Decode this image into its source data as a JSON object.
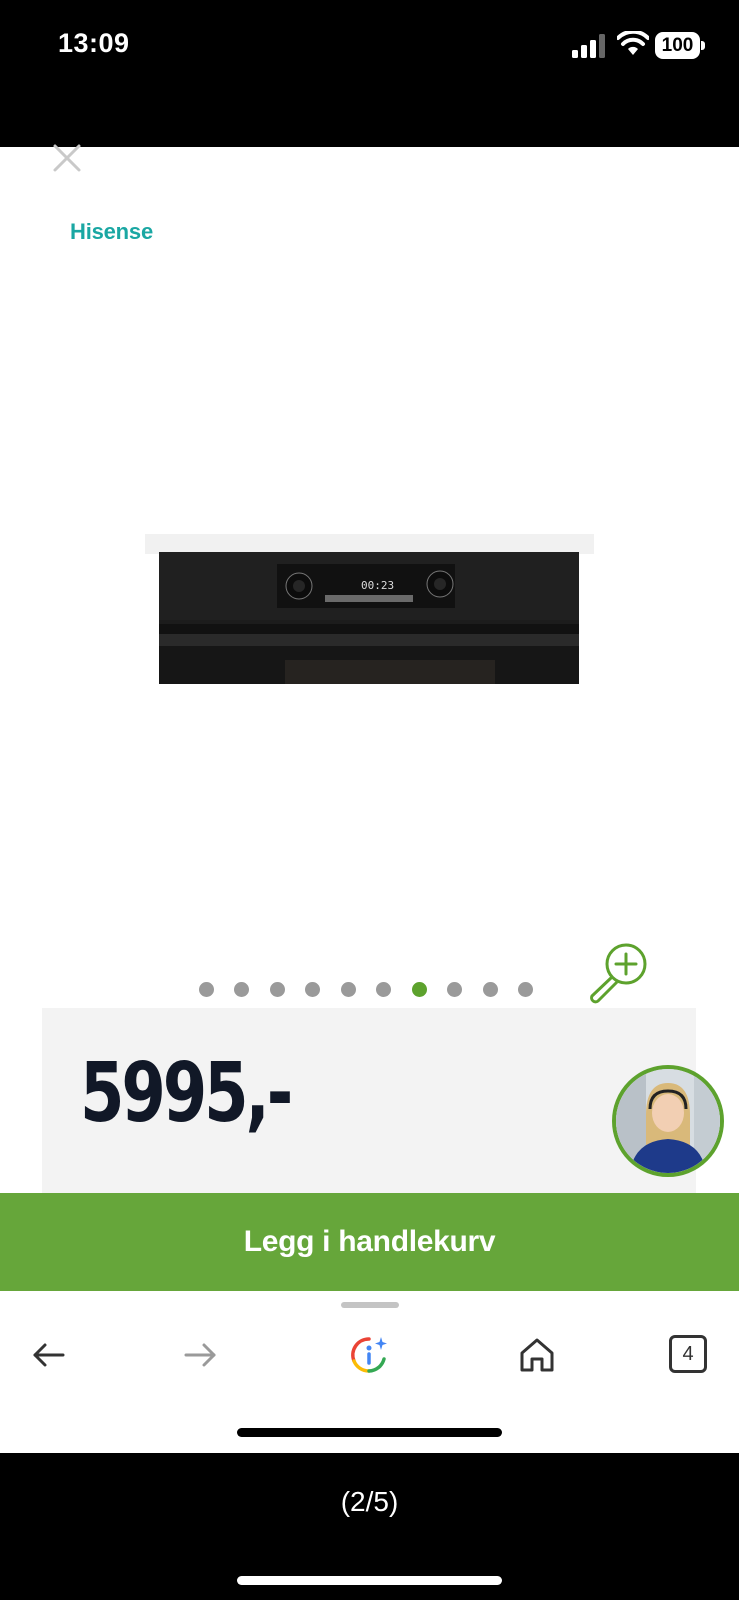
{
  "status_bar": {
    "time": "13:09",
    "battery": "100",
    "icons": [
      "signal-icon",
      "wifi-icon",
      "battery-icon"
    ]
  },
  "product": {
    "brand": "Hisense",
    "display_time": "00:23",
    "price": "5995,-",
    "image_count": 10,
    "active_image_index": 6,
    "add_to_cart_label": "Legg i handlekurv"
  },
  "toolbar": {
    "icons": [
      "back-arrow-icon",
      "forward-arrow-icon",
      "google-lens-icon",
      "home-icon",
      "tabs-icon"
    ],
    "tabs_count": "4"
  },
  "viewer": {
    "page_counter": "(2/5)"
  },
  "colors": {
    "brand": "#1aa7a3",
    "accent_green": "#66a63a",
    "active_dot": "#5da22d",
    "inactive_dot": "#9a9a9a",
    "price_text": "#111827"
  }
}
